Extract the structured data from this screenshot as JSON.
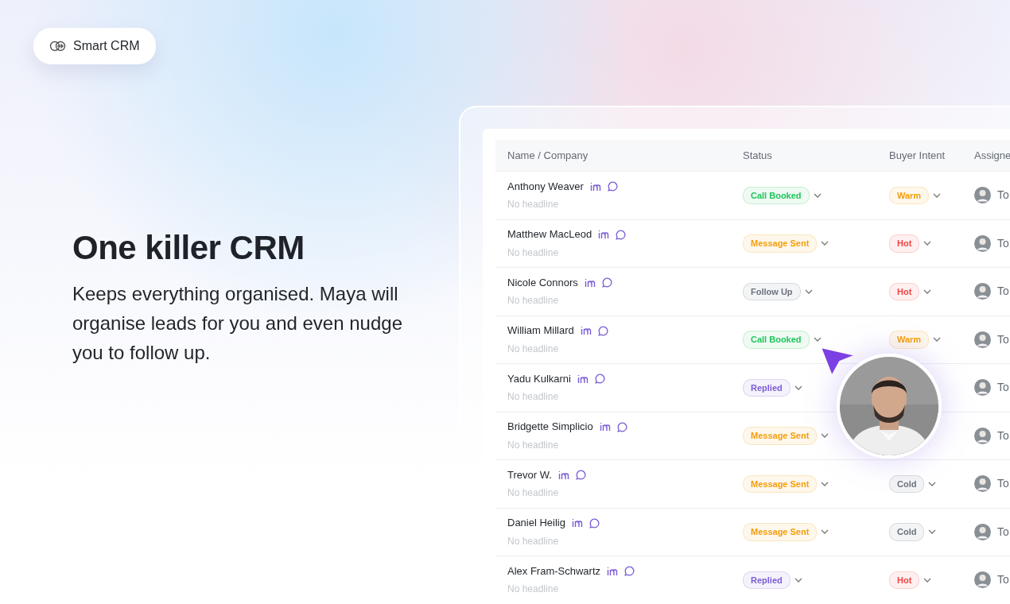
{
  "badge": {
    "label": "Smart CRM"
  },
  "hero": {
    "title": "One killer **CRM**",
    "text": "Keeps everything organised. Maya will organise leads for you and even nudge you to follow up."
  },
  "table": {
    "columns": [
      "Name / Company",
      "Status",
      "Buyer Intent",
      "Assigne"
    ],
    "rows": [
      {
        "name": "Anthony Weaver",
        "headline": "No headline",
        "status": {
          "label": "Call Booked",
          "color": "#22c55e"
        },
        "intent": {
          "label": "Warm",
          "color": "#f59e0b"
        },
        "assignee": "To"
      },
      {
        "name": "Matthew MacLeod",
        "headline": "No headline",
        "status": {
          "label": "Message Sent",
          "color": "#f59e0b"
        },
        "intent": {
          "label": "Hot",
          "color": "#ef4444"
        },
        "assignee": "To"
      },
      {
        "name": "Nicole Connors",
        "headline": "No headline",
        "status": {
          "label": "Follow Up",
          "color": "#6b7280"
        },
        "intent": {
          "label": "Hot",
          "color": "#ef4444"
        },
        "assignee": "To"
      },
      {
        "name": "William Millard",
        "headline": "No headline",
        "status": {
          "label": "Call Booked",
          "color": "#22c55e"
        },
        "intent": {
          "label": "Warm",
          "color": "#f59e0b"
        },
        "assignee": "To"
      },
      {
        "name": "Yadu Kulkarni",
        "headline": "No headline",
        "status": {
          "label": "Replied",
          "color": "#7c5cd6"
        },
        "assignee": "To"
      },
      {
        "name": "Bridgette Simplicio",
        "headline": "No headline",
        "status": {
          "label": "Message Sent",
          "color": "#f59e0b"
        },
        "assignee": "To"
      },
      {
        "name": "Trevor W.",
        "headline": "No headline",
        "status": {
          "label": "Message Sent",
          "color": "#f59e0b"
        },
        "intent": {
          "label": "Cold",
          "color": "#6b7280"
        },
        "assignee": "To"
      },
      {
        "name": "Daniel Heilig",
        "headline": "No headline",
        "status": {
          "label": "Message Sent",
          "color": "#f59e0b"
        },
        "intent": {
          "label": "Cold",
          "color": "#6b7280"
        },
        "assignee": "To"
      },
      {
        "name": "Alex Fram-Schwartz",
        "headline": "No headline",
        "status": {
          "label": "Replied",
          "color": "#7c5cd6"
        },
        "intent": {
          "label": "Hot",
          "color": "#ef4444"
        },
        "assignee": "To"
      }
    ]
  }
}
